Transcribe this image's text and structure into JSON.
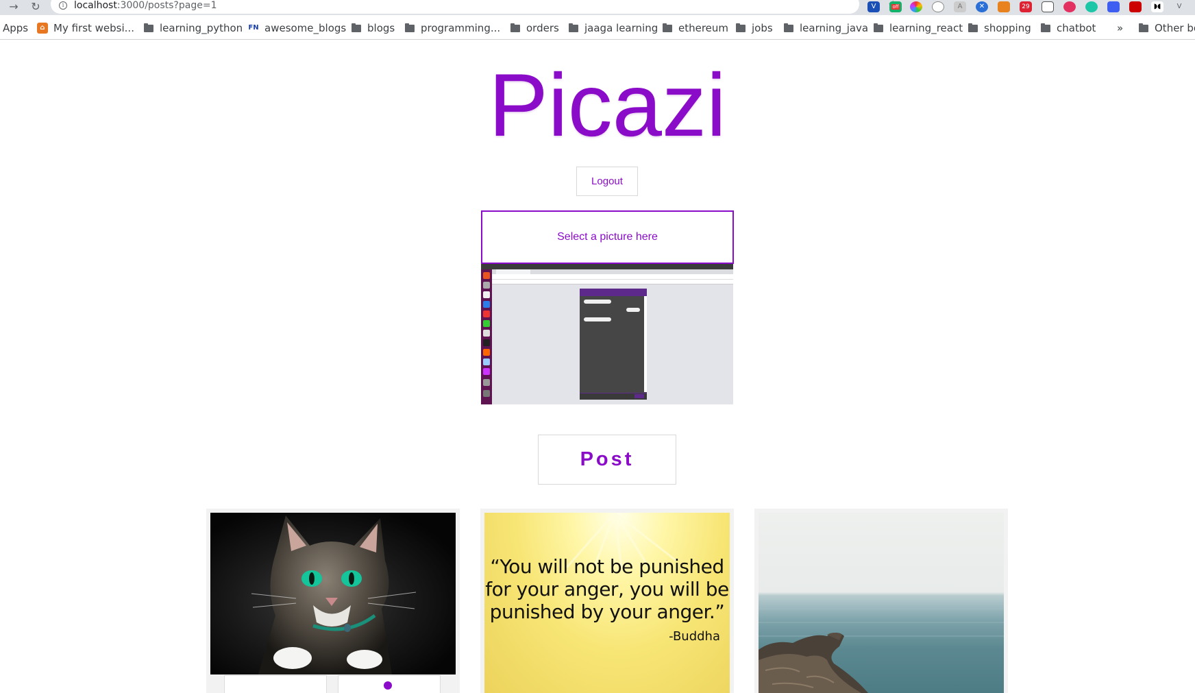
{
  "browser": {
    "url_host": "localhost",
    "url_path": ":3000/posts?page=1",
    "bookmarks": [
      {
        "label": "Apps",
        "icon": "apps-icon"
      },
      {
        "label": "My first websi...",
        "icon": "site-icon"
      },
      {
        "label": "learning_python",
        "icon": "folder-icon"
      },
      {
        "label": "awesome_blogs",
        "icon": "fn-icon"
      },
      {
        "label": "blogs",
        "icon": "folder-icon"
      },
      {
        "label": "programming...",
        "icon": "folder-icon"
      },
      {
        "label": "orders",
        "icon": "folder-icon"
      },
      {
        "label": "jaaga learning",
        "icon": "folder-icon"
      },
      {
        "label": "ethereum",
        "icon": "folder-icon"
      },
      {
        "label": "jobs",
        "icon": "folder-icon"
      },
      {
        "label": "learning_java",
        "icon": "folder-icon"
      },
      {
        "label": "learning_react",
        "icon": "folder-icon"
      },
      {
        "label": "shopping",
        "icon": "folder-icon"
      },
      {
        "label": "chatbot",
        "icon": "folder-icon"
      }
    ],
    "overflow": "»",
    "other_bookmarks": "Other bo",
    "ext_badge_off": "off",
    "ext_badge_29": "29"
  },
  "page": {
    "logo": "Picazi",
    "logout_label": "Logout",
    "picker_label": "Select a picture here",
    "post_label": "Post"
  },
  "cards": [
    {
      "alt": "cat photo"
    },
    {
      "quote": "“You will not be punished for your anger, you will be punished by your anger.”",
      "author": "-Buddha"
    },
    {
      "alt": "sea and rocks photo"
    }
  ],
  "colors": {
    "accent": "#8a0cc8",
    "border": "#d8d8d8"
  }
}
